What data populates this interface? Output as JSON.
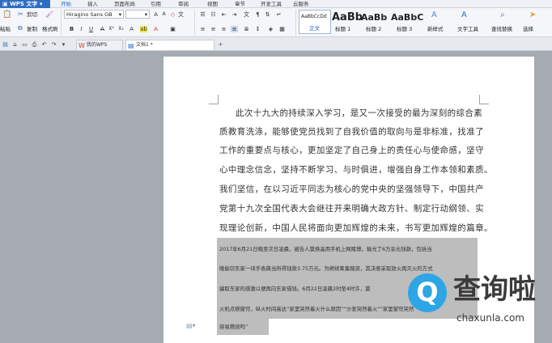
{
  "app": {
    "name": "WPS 文字"
  },
  "menu": {
    "tabs": [
      "开始",
      "插入",
      "页面布局",
      "引用",
      "审阅",
      "视图",
      "章节",
      "开发工具",
      "云服务"
    ],
    "active": 0
  },
  "ribbon": {
    "cut": "剪切",
    "paste": "粘贴",
    "copy": "复制",
    "format_painter": "格式刷",
    "font_name": "Hiragino Sans GB",
    "font_size": "",
    "styles": [
      {
        "preview": "AaBbCcDd",
        "label": "正文"
      },
      {
        "preview": "AaBb",
        "label": "标题 1"
      },
      {
        "preview": "AaBb",
        "label": "标题 2"
      },
      {
        "preview": "AaBbC",
        "label": "标题 3"
      }
    ],
    "new_style": "新样式",
    "text_tools": "文字工具",
    "find_replace": "查找替换",
    "select": "选择"
  },
  "doc_tabs": [
    {
      "label": "我的WPS",
      "active": false
    },
    {
      "label": "文档1 *",
      "active": true
    }
  ],
  "document": {
    "paragraph": [
      "此次十九大的持续深入学习，是又一次接受的最为深刻的综合素",
      "质教育洗涤，能够使党员找到了自我价值的取向与是非标准，找准了",
      "工作的重要点与核心，更加坚定了自己身上的责任心与使命感，坚守",
      "心中理念信念，坚持不断学习、与时俱进，增强自身工作本领和素质。",
      "我们坚信，在以习近平同志为核心的党中央的坚强领导下，中国共产",
      "党第十九次全国代表大会继往开来明确大政方针、制定行动纲领、实",
      "现理论创新，中国人民将面向更加辉煌的未来，书写更加辉煌的篇章。"
    ],
    "selected": [
      "2017年6月21日晚至次日凌晨，被告人莫焕晶用手机上网赌博，输光了6万余元钱款，包括当",
      "晚偷窃东家一块手表典当所得钱款3.75万元。为继续筹集赌资，其决意采取放火再灭火的方式",
      "骗取东家的感激以便再向东家借钱。6月22日凌晨2时至4时许，莫",
      "火机点燃窗帘，纵火时间高达“家里突然着火什么原因”“沙发突然着火”“家里窗帘突然",
      "容易燃烧吗”"
    ]
  },
  "watermark": {
    "icon": "Q",
    "name": "查询啦",
    "url": "chaxunla.com"
  }
}
